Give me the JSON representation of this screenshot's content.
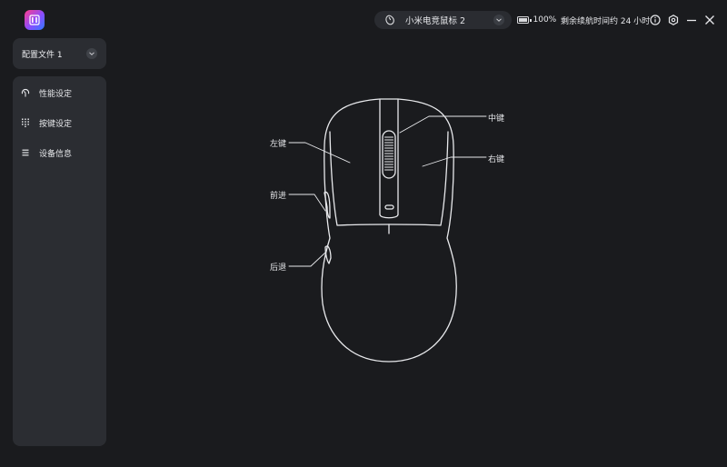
{
  "device": {
    "name": "小米电竞鼠标 2"
  },
  "battery": {
    "percent_label": "100%",
    "level": 1.0
  },
  "runtime": {
    "text": "剩余续航时间约 24 小时"
  },
  "profile": {
    "label": "配置文件 1"
  },
  "sidebar": {
    "items": [
      {
        "label": "性能设定",
        "icon": "dpi-dial-icon"
      },
      {
        "label": "按键设定",
        "icon": "grid-dots-icon"
      },
      {
        "label": "设备信息",
        "icon": "list-icon"
      }
    ]
  },
  "buttons": {
    "left": "左键",
    "middle": "中键",
    "right": "右键",
    "forward": "前进",
    "back": "后退"
  },
  "window_controls": [
    "info-icon",
    "settings-icon",
    "minimize-icon",
    "close-icon"
  ],
  "colors": {
    "background": "#1a1b1e",
    "panel": "#2b2d32",
    "line": "#e8e9ec"
  }
}
